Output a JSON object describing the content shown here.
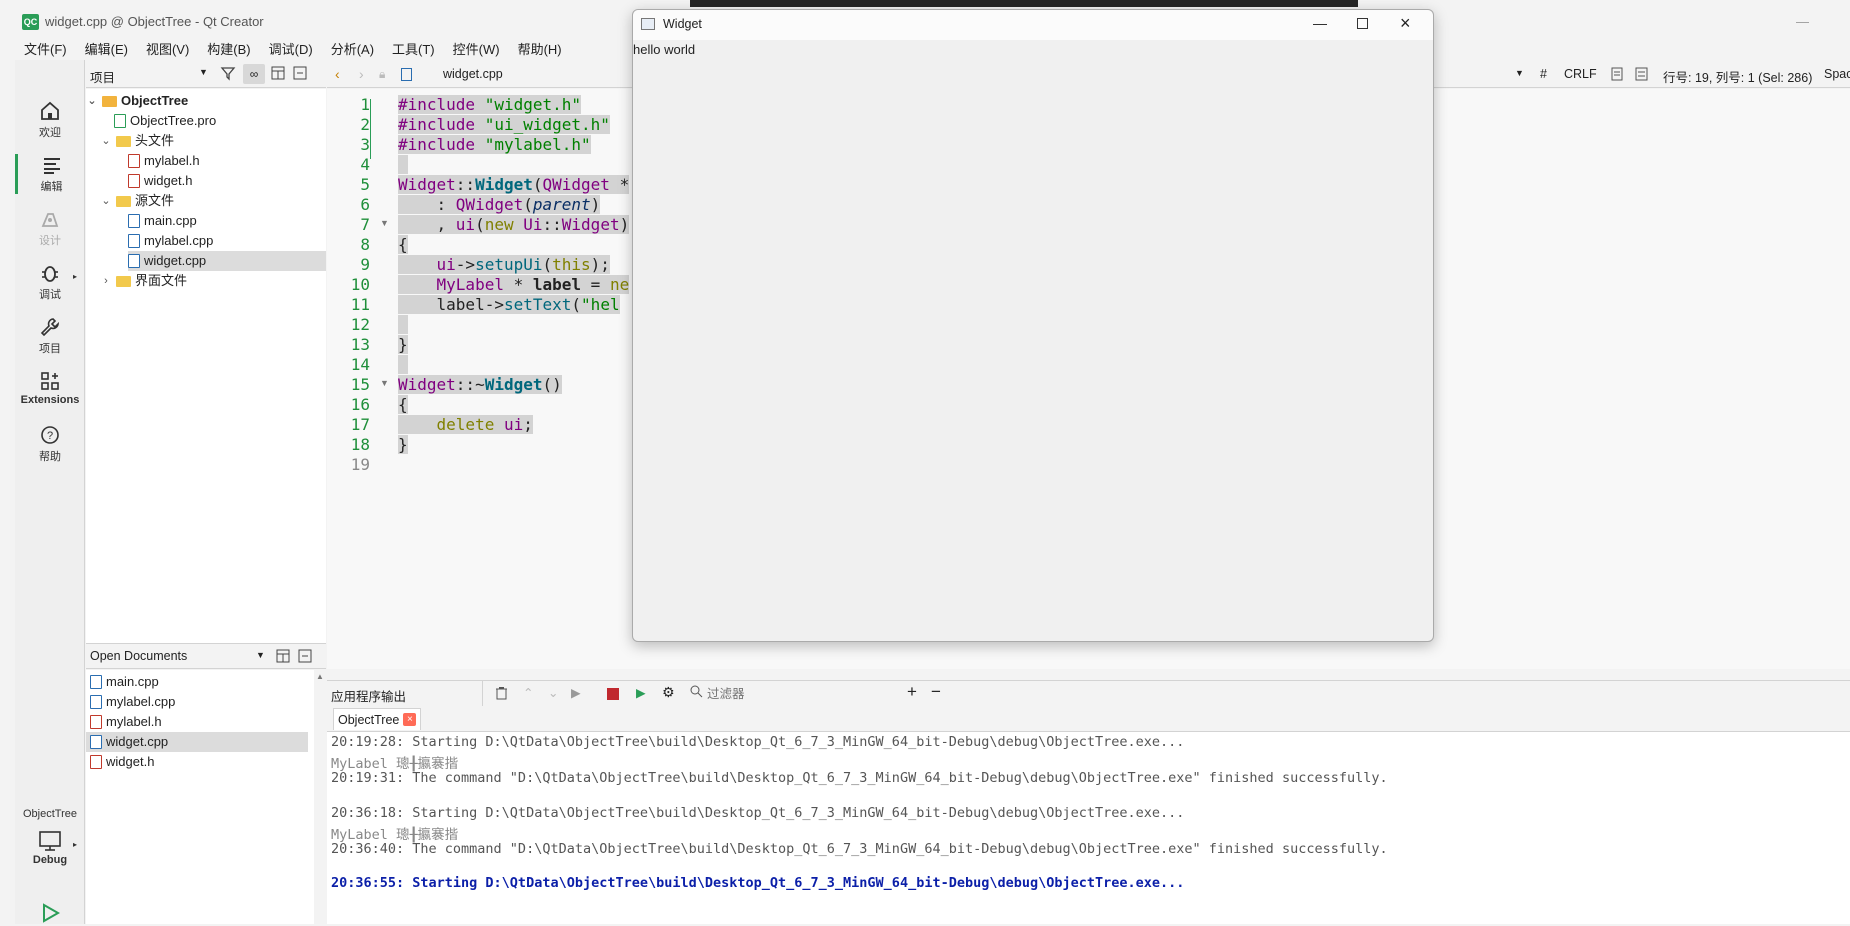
{
  "app": {
    "title": "widget.cpp @ ObjectTree - Qt Creator",
    "logo": "QC",
    "accent": "#2a9d57"
  },
  "menu": [
    "文件(F)",
    "编辑(E)",
    "视图(V)",
    "构建(B)",
    "调试(D)",
    "分析(A)",
    "工具(T)",
    "控件(W)",
    "帮助(H)"
  ],
  "modes": [
    {
      "label": "欢迎",
      "icon": "home-icon"
    },
    {
      "label": "编辑",
      "icon": "edit-icon"
    },
    {
      "label": "设计",
      "icon": "design-icon"
    },
    {
      "label": "调试",
      "icon": "bug-icon"
    },
    {
      "label": "项目",
      "icon": "wrench-icon"
    },
    {
      "label": "Extensions",
      "icon": "extensions-icon"
    },
    {
      "label": "帮助",
      "icon": "help-icon"
    }
  ],
  "kit": {
    "project": "ObjectTree",
    "config": "Debug"
  },
  "project_panel": {
    "title": "项目",
    "tree": [
      {
        "label": "ObjectTree",
        "type": "project",
        "expanded": true
      },
      {
        "label": "ObjectTree.pro",
        "type": "pro"
      },
      {
        "label": "头文件",
        "type": "folder",
        "expanded": true
      },
      {
        "label": "mylabel.h",
        "type": "h"
      },
      {
        "label": "widget.h",
        "type": "h"
      },
      {
        "label": "源文件",
        "type": "folder",
        "expanded": true
      },
      {
        "label": "main.cpp",
        "type": "cpp"
      },
      {
        "label": "mylabel.cpp",
        "type": "cpp"
      },
      {
        "label": "widget.cpp",
        "type": "cpp",
        "selected": true
      },
      {
        "label": "界面文件",
        "type": "folder",
        "expanded": false
      }
    ]
  },
  "open_documents": {
    "title": "Open Documents",
    "items": [
      "main.cpp",
      "mylabel.cpp",
      "mylabel.h",
      "widget.cpp",
      "widget.h"
    ],
    "selected": "widget.cpp"
  },
  "editor": {
    "file": "widget.cpp",
    "line_ending": "CRLF",
    "hash": "#",
    "position": "行号: 19, 列号: 1 (Sel: 286)",
    "spaces": "Spac",
    "lines": [
      "1",
      "2",
      "3",
      "4",
      "5",
      "6",
      "7",
      "8",
      "9",
      "10",
      "11",
      "12",
      "13",
      "14",
      "15",
      "16",
      "17",
      "18",
      "19"
    ]
  },
  "widget_window": {
    "title": "Widget",
    "label_text": "hello world"
  },
  "output": {
    "title": "应用程序输出",
    "filter_placeholder": "过滤器",
    "tab": "ObjectTree",
    "lines": [
      {
        "text": "20:19:28: Starting D:\\QtData\\ObjectTree\\build\\Desktop_Qt_6_7_3_MinGW_64_bit-Debug\\debug\\ObjectTree.exe...",
        "style": "gray"
      },
      {
        "text": "MyLabel 璁╂攍褰揩",
        "style": "gray-light"
      },
      {
        "text": "20:19:31: The command \"D:\\QtData\\ObjectTree\\build\\Desktop_Qt_6_7_3_MinGW_64_bit-Debug\\debug\\ObjectTree.exe\" finished successfully.",
        "style": "gray"
      },
      {
        "text": "",
        "style": "gray"
      },
      {
        "text": "20:36:18: Starting D:\\QtData\\ObjectTree\\build\\Desktop_Qt_6_7_3_MinGW_64_bit-Debug\\debug\\ObjectTree.exe...",
        "style": "gray"
      },
      {
        "text": "MyLabel 璁╂攍褰揩",
        "style": "gray-light"
      },
      {
        "text": "20:36:40: The command \"D:\\QtData\\ObjectTree\\build\\Desktop_Qt_6_7_3_MinGW_64_bit-Debug\\debug\\ObjectTree.exe\" finished successfully.",
        "style": "gray"
      },
      {
        "text": "",
        "style": "gray"
      },
      {
        "text": "20:36:55: Starting D:\\QtData\\ObjectTree\\build\\Desktop_Qt_6_7_3_MinGW_64_bit-Debug\\debug\\ObjectTree.exe...",
        "style": "blue"
      }
    ]
  }
}
